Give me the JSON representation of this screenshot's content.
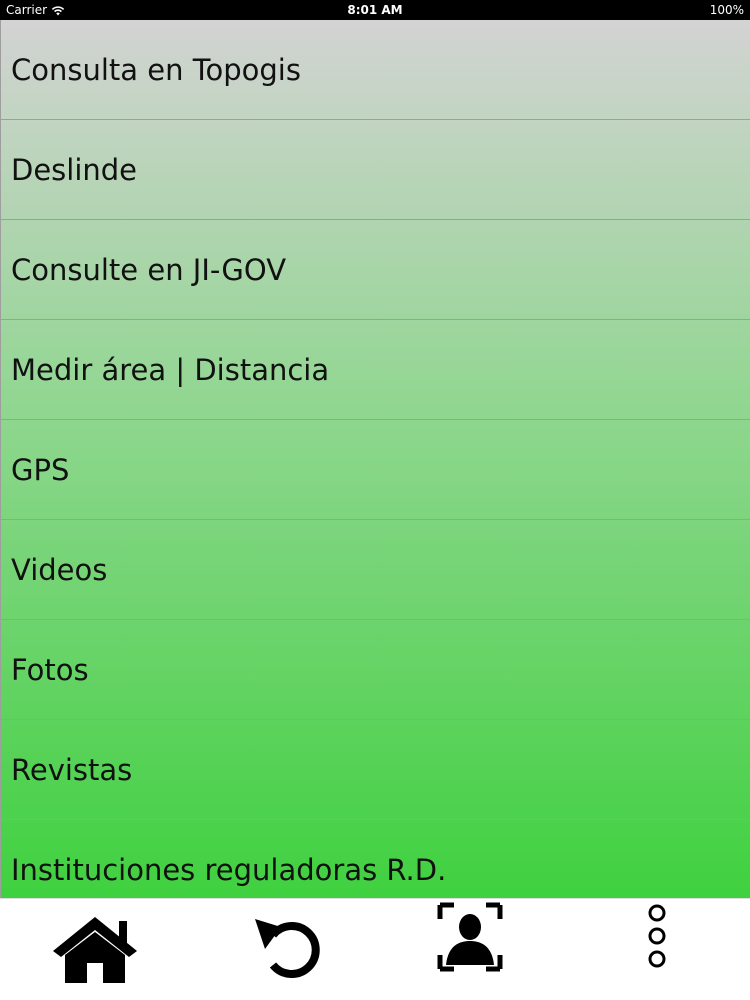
{
  "status_bar": {
    "carrier": "Carrier",
    "time": "8:01 AM",
    "battery": "100%",
    "wifi_icon": "wifi-icon"
  },
  "menu": {
    "items": [
      {
        "label": "Consulta en Topogis"
      },
      {
        "label": "Deslinde"
      },
      {
        "label": "Consulte en JI-GOV"
      },
      {
        "label": "Medir área | Distancia"
      },
      {
        "label": "GPS"
      },
      {
        "label": "Videos"
      },
      {
        "label": "Fotos"
      },
      {
        "label": "Revistas"
      },
      {
        "label": "Instituciones reguladoras R.D."
      }
    ]
  },
  "tab_bar": {
    "icons": [
      "home-icon",
      "refresh-icon",
      "contact-icon",
      "more-icon"
    ]
  },
  "colors": {
    "gradient_top": "#d3d3d3",
    "gradient_bottom": "#3fd13f",
    "status_bar_bg": "#000000"
  }
}
